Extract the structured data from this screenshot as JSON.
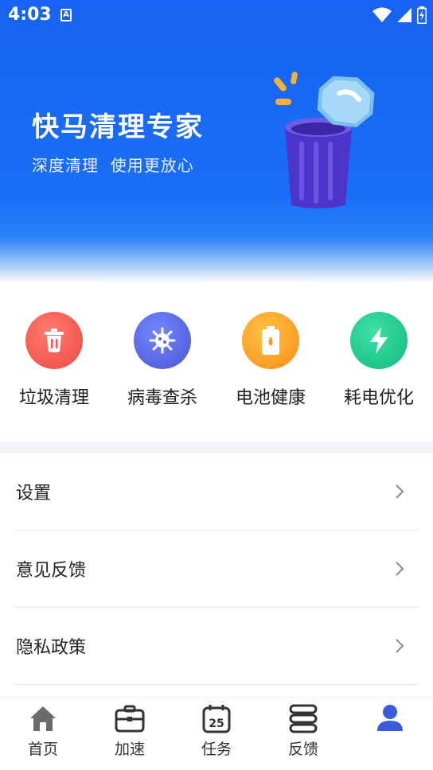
{
  "status_bar": {
    "time": "4:03",
    "notification_icon": "a-icon",
    "icons": [
      "wifi-icon",
      "signal-icon",
      "battery-icon"
    ]
  },
  "hero": {
    "title": "快马清理专家",
    "subtitle": "深度清理  使用更放心",
    "art": "trash-can-illustration"
  },
  "features": [
    {
      "label": "垃圾清理",
      "icon": "trash-icon",
      "color": "#f2564e"
    },
    {
      "label": "病毒查杀",
      "icon": "virus-icon",
      "color": "#5466e0"
    },
    {
      "label": "电池健康",
      "icon": "battery-icon",
      "color": "#fd9a1c"
    },
    {
      "label": "耗电优化",
      "icon": "bolt-icon",
      "color": "#1cc98e"
    }
  ],
  "menu": [
    {
      "label": "设置"
    },
    {
      "label": "意见反馈"
    },
    {
      "label": "隐私政策"
    }
  ],
  "bottom_nav": [
    {
      "label": "首页",
      "icon": "home-icon",
      "active": false
    },
    {
      "label": "加速",
      "icon": "briefcase-icon",
      "active": false
    },
    {
      "label": "任务",
      "icon": "calendar-icon",
      "calendar_day": "25",
      "active": false
    },
    {
      "label": "反馈",
      "icon": "stack-icon",
      "active": false
    },
    {
      "label": "",
      "icon": "profile-icon",
      "active": true
    }
  ],
  "colors": {
    "primary_blue": "#1763f3",
    "active_nav": "#3b5bdb",
    "nav_inactive": "#555555"
  }
}
